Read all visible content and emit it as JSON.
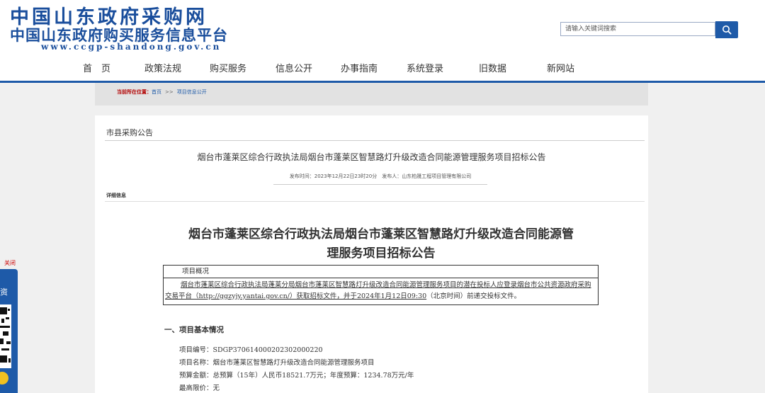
{
  "header": {
    "logo_line1": "中国山东政府采购网",
    "logo_line2": "中国山东政府购买服务信息平台",
    "logo_url": "www.ccgp-shandong.gov.cn",
    "search_placeholder": "请输入关键词搜索",
    "search_icon": "search-icon"
  },
  "nav": {
    "items": [
      "首　页",
      "政策法规",
      "购买服务",
      "信息公开",
      "办事指南",
      "系统登录",
      "旧数据",
      "新网站"
    ]
  },
  "breadcrumb": {
    "label": "当前所在位置：",
    "home": "首页",
    "sep": ">>",
    "current": "项目信息公开"
  },
  "section": {
    "title": "市县采购公告"
  },
  "article": {
    "title": "烟台市蓬莱区综合行政执法局烟台市蓬莱区智慧路灯升级改造合同能源管理服务项目招标公告",
    "meta": "发布时间：2023年12月22日23时20分　发布人：山东柏晟工程项目管理有限公司",
    "detail_label": "详细信息",
    "doc_title_line1": "烟台市蓬莱区综合行政执法局烟台市蓬莱区智慧路灯升级改造合同能源管",
    "doc_title_line2": "理服务项目招标公告",
    "overview_header": "项目概况",
    "overview_text_a": "烟台市蓬莱区综合行政执法局蓬莱分局烟台市蓬莱区智慧路灯升级改造合同能源管理服务项目的潜在投标人应登录烟台市公共资源政府采购交易平台（http://ggzyjy.yantai.gov.cn/）获取招标文件，并于",
    "overview_text_date": "2024年1月12日09:30",
    "overview_text_b": "（北京时间）前递交投标文件。",
    "section1_title": "一、项目基本情况",
    "info_lines": [
      "项目编号：SDGP370614000202302000220",
      "项目名称：烟台市蓬莱区智慧路灯升级改造合同能源管理服务项目",
      "预算金额：总预算（15年）人民币18521.7万元；年度预算：1234.78万元/年",
      "最高限价：无"
    ]
  },
  "side_panel": {
    "close": "关闭",
    "text": "资"
  },
  "colors": {
    "brand_blue": "#1e5aa8",
    "logo_blue": "#1a4e9c",
    "crumb_red": "#b20000"
  }
}
